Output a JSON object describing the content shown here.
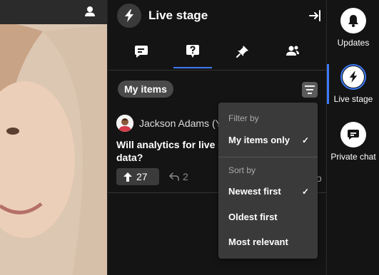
{
  "panel": {
    "title": "Live stage",
    "tabs": [
      {
        "name": "chat",
        "icon": "message-icon"
      },
      {
        "name": "questions",
        "icon": "question-icon",
        "active": true
      },
      {
        "name": "pinned",
        "icon": "pin-icon"
      },
      {
        "name": "people",
        "icon": "people-icon"
      }
    ]
  },
  "filter_chip": "My items",
  "question": {
    "author": "Jackson Adams (Y",
    "text": "Will analytics for live e participant-level data?",
    "upvotes": "27",
    "replies": "2",
    "trailing": "o"
  },
  "dropdown": {
    "filter_heading": "Filter by",
    "filter_items": [
      {
        "label": "My items only",
        "checked": true
      }
    ],
    "sort_heading": "Sort by",
    "sort_items": [
      {
        "label": "Newest first",
        "checked": true
      },
      {
        "label": "Oldest first",
        "checked": false
      },
      {
        "label": "Most relevant",
        "checked": false
      }
    ],
    "check_glyph": "✓"
  },
  "rail": {
    "updates": "Updates",
    "live_stage": "Live stage",
    "private_chat": "Private chat"
  },
  "colors": {
    "accent": "#3d7bf7",
    "panel_bg": "#141414",
    "dropdown_bg": "#3a3a3a"
  }
}
